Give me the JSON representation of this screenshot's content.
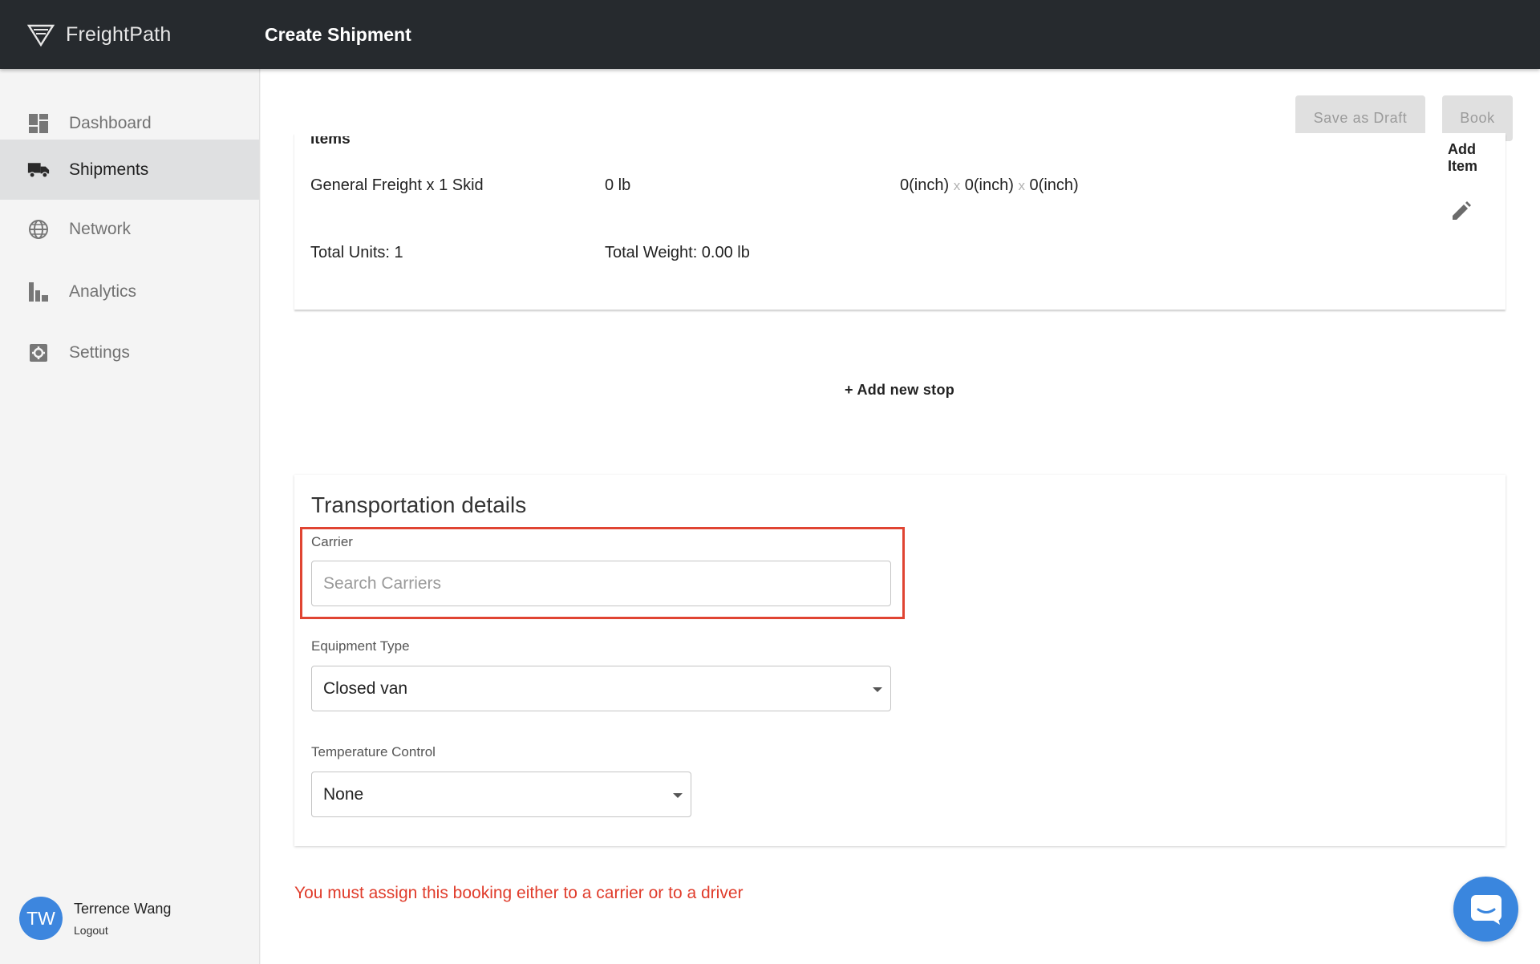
{
  "app": {
    "brand": "FreightPath",
    "page_title": "Create Shipment"
  },
  "sidebar": {
    "items": [
      {
        "label": "Dashboard",
        "icon": "dashboard-icon"
      },
      {
        "label": "Shipments",
        "icon": "truck-icon",
        "active": true
      },
      {
        "label": "Network",
        "icon": "globe-icon"
      },
      {
        "label": "Analytics",
        "icon": "bar-chart-icon"
      },
      {
        "label": "Settings",
        "icon": "gear-icon"
      }
    ],
    "user": {
      "initials": "TW",
      "name": "Terrence Wang",
      "logout_label": "Logout"
    }
  },
  "toolbar": {
    "save_draft_label": "Save as Draft",
    "book_label": "Book"
  },
  "items_section": {
    "title": "Items",
    "add_item_label": "Add Item",
    "rows": [
      {
        "description": "General Freight x 1 Skid",
        "weight": "0 lb",
        "dimensions": [
          "0(inch)",
          "0(inch)",
          "0(inch)"
        ],
        "separator": "x"
      }
    ],
    "total_units": "Total Units: 1",
    "total_weight": "Total Weight: 0.00 lb"
  },
  "add_stop_label": "+ Add new stop",
  "transportation": {
    "title": "Transportation details",
    "carrier": {
      "label": "Carrier",
      "placeholder": "Search Carriers",
      "value": ""
    },
    "equipment": {
      "label": "Equipment Type",
      "value": "Closed van"
    },
    "temperature": {
      "label": "Temperature Control",
      "value": "None"
    }
  },
  "error_message": "You must assign this booking either to a carrier or to a driver",
  "colors": {
    "accent": "#3a86de",
    "error": "#e03c2b",
    "topbar": "#262a2e",
    "highlight": "#e04432"
  }
}
